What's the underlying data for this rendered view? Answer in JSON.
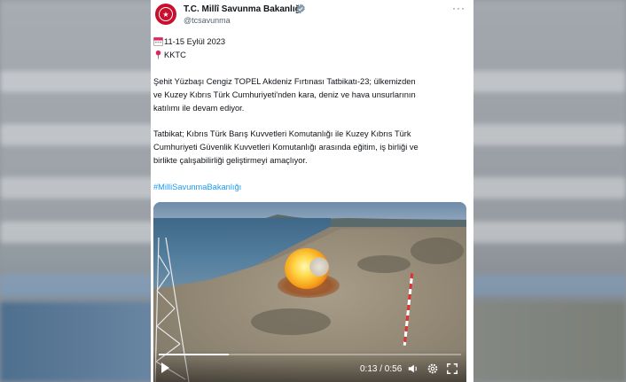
{
  "tweet": {
    "author_name": "T.C. Millî Savunma Bakanlığı",
    "handle": "@tcsavunma",
    "more_label": "···",
    "date_line": "11-15 Eylül 2023",
    "location_line": "KKTC",
    "paragraph1": [
      "Şehit Yüzbaşı Cengiz TOPEL Akdeniz Fırtınası Tatbikatı-23; ülkemizden",
      "ve Kuzey Kıbrıs Türk Cumhuriyeti'nden kara, deniz ve hava unsurlarının",
      "katılımı ile devam ediyor."
    ],
    "paragraph2": [
      "Tatbikat; Kıbrıs Türk Barış Kuvvetleri Komutanlığı ile Kuzey Kıbrıs Türk",
      "Cumhuriyeti Güvenlik Kuvvetleri Komutanlığı arasında eğitim, iş birliği ve",
      "birlikte çalışabilirliği geliştirmeyi amaçlıyor."
    ],
    "hashtag": "#MilliSavunmaBakanlığı"
  },
  "video": {
    "time_display": "0:13 / 0:56",
    "progress_fraction": 0.232
  },
  "icons": {
    "calendar": "calendar-icon",
    "pin": "round-pushpin-icon",
    "verified": "verified-badge-icon",
    "play": "play-icon",
    "volume": "volume-icon",
    "settings": "gear-icon",
    "fullscreen": "fullscreen-icon"
  },
  "colors": {
    "accent": "#1d9bf0",
    "text": "#0f1419",
    "muted": "#536471",
    "brand_red": "#c8102e"
  }
}
